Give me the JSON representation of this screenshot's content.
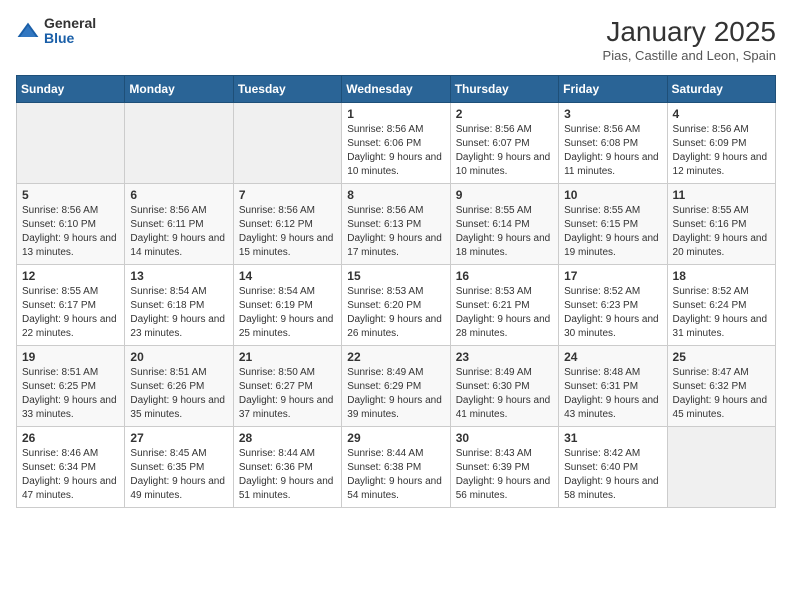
{
  "logo": {
    "general": "General",
    "blue": "Blue"
  },
  "title": "January 2025",
  "location": "Pias, Castille and Leon, Spain",
  "days_of_week": [
    "Sunday",
    "Monday",
    "Tuesday",
    "Wednesday",
    "Thursday",
    "Friday",
    "Saturday"
  ],
  "weeks": [
    [
      {
        "day": "",
        "info": ""
      },
      {
        "day": "",
        "info": ""
      },
      {
        "day": "",
        "info": ""
      },
      {
        "day": "1",
        "info": "Sunrise: 8:56 AM\nSunset: 6:06 PM\nDaylight: 9 hours and 10 minutes."
      },
      {
        "day": "2",
        "info": "Sunrise: 8:56 AM\nSunset: 6:07 PM\nDaylight: 9 hours and 10 minutes."
      },
      {
        "day": "3",
        "info": "Sunrise: 8:56 AM\nSunset: 6:08 PM\nDaylight: 9 hours and 11 minutes."
      },
      {
        "day": "4",
        "info": "Sunrise: 8:56 AM\nSunset: 6:09 PM\nDaylight: 9 hours and 12 minutes."
      }
    ],
    [
      {
        "day": "5",
        "info": "Sunrise: 8:56 AM\nSunset: 6:10 PM\nDaylight: 9 hours and 13 minutes."
      },
      {
        "day": "6",
        "info": "Sunrise: 8:56 AM\nSunset: 6:11 PM\nDaylight: 9 hours and 14 minutes."
      },
      {
        "day": "7",
        "info": "Sunrise: 8:56 AM\nSunset: 6:12 PM\nDaylight: 9 hours and 15 minutes."
      },
      {
        "day": "8",
        "info": "Sunrise: 8:56 AM\nSunset: 6:13 PM\nDaylight: 9 hours and 17 minutes."
      },
      {
        "day": "9",
        "info": "Sunrise: 8:55 AM\nSunset: 6:14 PM\nDaylight: 9 hours and 18 minutes."
      },
      {
        "day": "10",
        "info": "Sunrise: 8:55 AM\nSunset: 6:15 PM\nDaylight: 9 hours and 19 minutes."
      },
      {
        "day": "11",
        "info": "Sunrise: 8:55 AM\nSunset: 6:16 PM\nDaylight: 9 hours and 20 minutes."
      }
    ],
    [
      {
        "day": "12",
        "info": "Sunrise: 8:55 AM\nSunset: 6:17 PM\nDaylight: 9 hours and 22 minutes."
      },
      {
        "day": "13",
        "info": "Sunrise: 8:54 AM\nSunset: 6:18 PM\nDaylight: 9 hours and 23 minutes."
      },
      {
        "day": "14",
        "info": "Sunrise: 8:54 AM\nSunset: 6:19 PM\nDaylight: 9 hours and 25 minutes."
      },
      {
        "day": "15",
        "info": "Sunrise: 8:53 AM\nSunset: 6:20 PM\nDaylight: 9 hours and 26 minutes."
      },
      {
        "day": "16",
        "info": "Sunrise: 8:53 AM\nSunset: 6:21 PM\nDaylight: 9 hours and 28 minutes."
      },
      {
        "day": "17",
        "info": "Sunrise: 8:52 AM\nSunset: 6:23 PM\nDaylight: 9 hours and 30 minutes."
      },
      {
        "day": "18",
        "info": "Sunrise: 8:52 AM\nSunset: 6:24 PM\nDaylight: 9 hours and 31 minutes."
      }
    ],
    [
      {
        "day": "19",
        "info": "Sunrise: 8:51 AM\nSunset: 6:25 PM\nDaylight: 9 hours and 33 minutes."
      },
      {
        "day": "20",
        "info": "Sunrise: 8:51 AM\nSunset: 6:26 PM\nDaylight: 9 hours and 35 minutes."
      },
      {
        "day": "21",
        "info": "Sunrise: 8:50 AM\nSunset: 6:27 PM\nDaylight: 9 hours and 37 minutes."
      },
      {
        "day": "22",
        "info": "Sunrise: 8:49 AM\nSunset: 6:29 PM\nDaylight: 9 hours and 39 minutes."
      },
      {
        "day": "23",
        "info": "Sunrise: 8:49 AM\nSunset: 6:30 PM\nDaylight: 9 hours and 41 minutes."
      },
      {
        "day": "24",
        "info": "Sunrise: 8:48 AM\nSunset: 6:31 PM\nDaylight: 9 hours and 43 minutes."
      },
      {
        "day": "25",
        "info": "Sunrise: 8:47 AM\nSunset: 6:32 PM\nDaylight: 9 hours and 45 minutes."
      }
    ],
    [
      {
        "day": "26",
        "info": "Sunrise: 8:46 AM\nSunset: 6:34 PM\nDaylight: 9 hours and 47 minutes."
      },
      {
        "day": "27",
        "info": "Sunrise: 8:45 AM\nSunset: 6:35 PM\nDaylight: 9 hours and 49 minutes."
      },
      {
        "day": "28",
        "info": "Sunrise: 8:44 AM\nSunset: 6:36 PM\nDaylight: 9 hours and 51 minutes."
      },
      {
        "day": "29",
        "info": "Sunrise: 8:44 AM\nSunset: 6:38 PM\nDaylight: 9 hours and 54 minutes."
      },
      {
        "day": "30",
        "info": "Sunrise: 8:43 AM\nSunset: 6:39 PM\nDaylight: 9 hours and 56 minutes."
      },
      {
        "day": "31",
        "info": "Sunrise: 8:42 AM\nSunset: 6:40 PM\nDaylight: 9 hours and 58 minutes."
      },
      {
        "day": "",
        "info": ""
      }
    ]
  ]
}
